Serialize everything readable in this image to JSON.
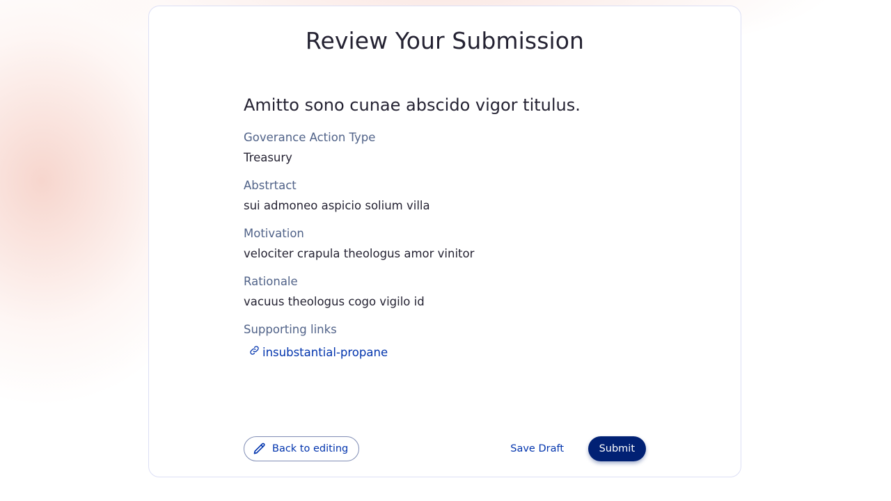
{
  "page": {
    "title": "Review Your Submission"
  },
  "proposal": {
    "title": "Amitto sono cunae abscido vigor titulus.",
    "fields": [
      {
        "label": "Goverance Action Type",
        "value": "Treasury"
      },
      {
        "label": "Abstrtact",
        "value": "sui admoneo aspicio solium villa"
      },
      {
        "label": "Motivation",
        "value": "velociter crapula theologus amor vinitor"
      },
      {
        "label": "Rationale",
        "value": "vacuus theologus cogo vigilo id"
      }
    ],
    "links_label": "Supporting links",
    "links": [
      {
        "text": "insubstantial-propane",
        "icon": "link-icon"
      }
    ]
  },
  "actions": {
    "back_label": "Back to editing",
    "back_icon": "pencil-icon",
    "save_draft_label": "Save Draft",
    "submit_label": "Submit"
  },
  "colors": {
    "primary": "#012174",
    "link": "#0033ad",
    "label": "#506288",
    "text": "#242232",
    "card_border": "#dcdff5"
  }
}
